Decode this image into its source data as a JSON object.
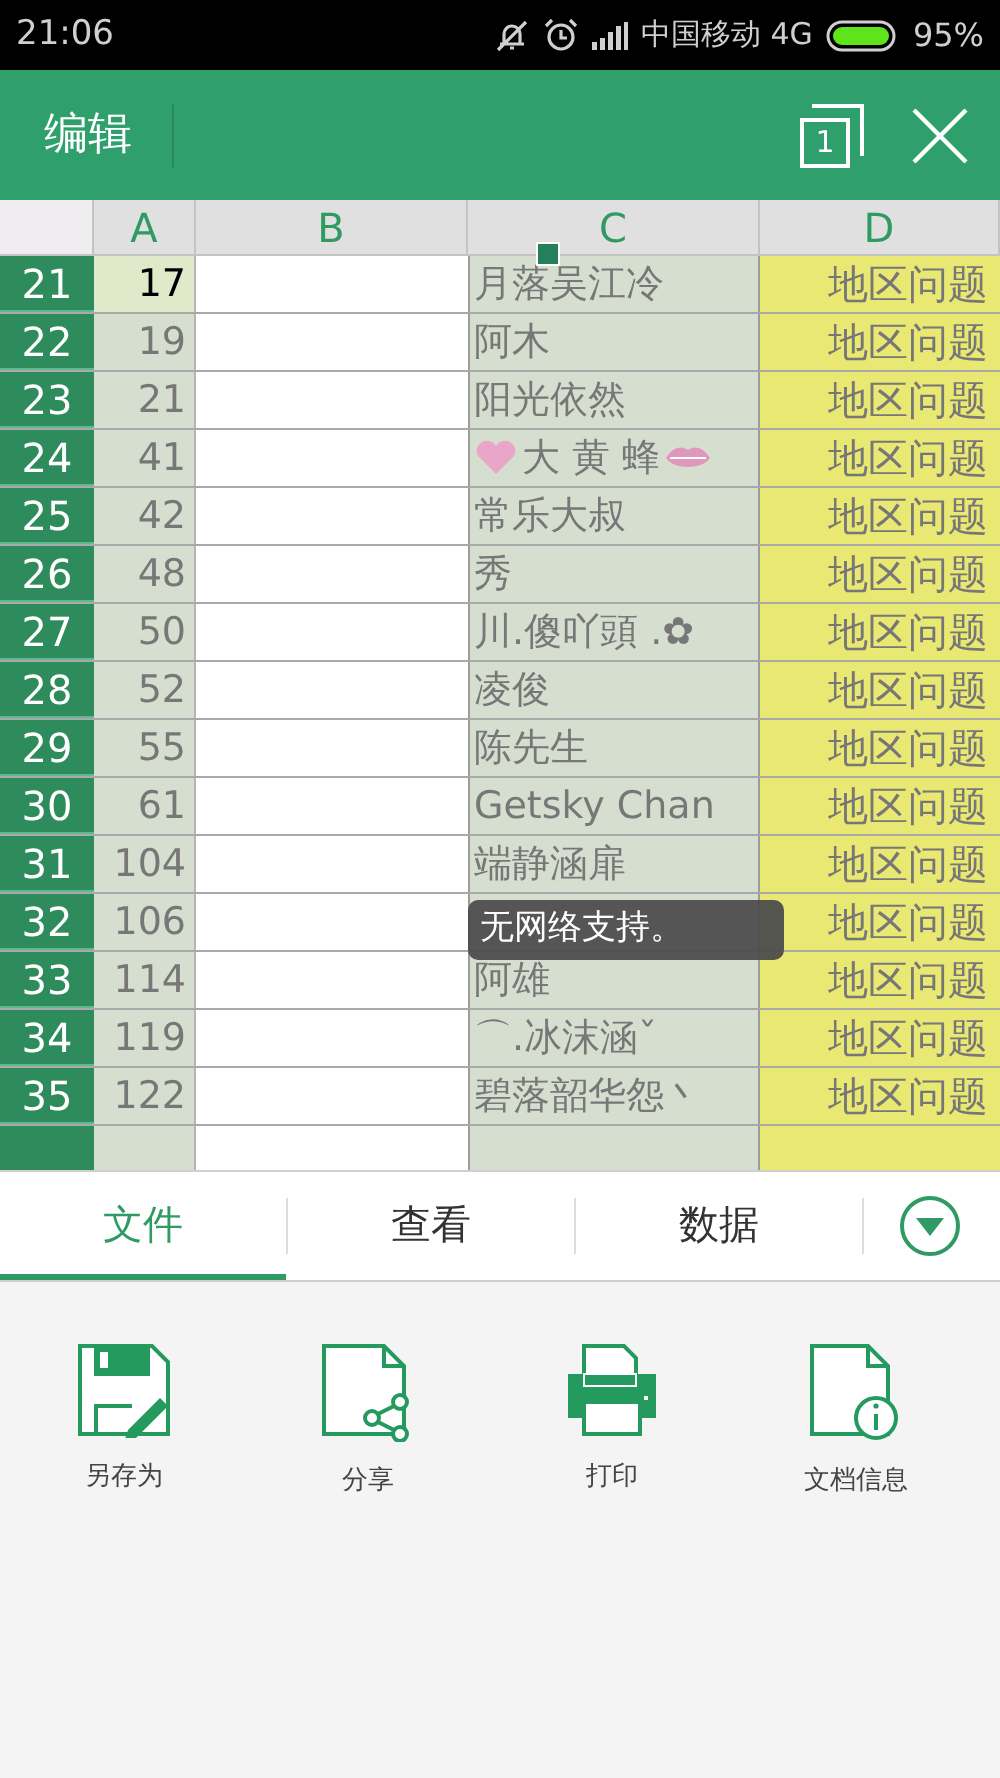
{
  "status_bar": {
    "time": "21:06",
    "carrier": "中国移动 4G",
    "battery": "95%"
  },
  "toolbar": {
    "title": "编辑",
    "window_count": "1"
  },
  "sheet": {
    "columns": [
      "A",
      "B",
      "C",
      "D"
    ],
    "rows": [
      {
        "num": "21",
        "a": "17",
        "c": "月落吴江冷",
        "d": "地区问题",
        "selected": true
      },
      {
        "num": "22",
        "a": "19",
        "c": "阿木",
        "d": "地区问题",
        "selected": false
      },
      {
        "num": "23",
        "a": "21",
        "c": "阳光依然",
        "d": "地区问题",
        "selected": false
      },
      {
        "num": "24",
        "a": "41",
        "c": "大 黄 蜂",
        "d": "地区问题",
        "selected": false,
        "kind": "decorated"
      },
      {
        "num": "25",
        "a": "42",
        "c": "常乐大叔",
        "d": "地区问题",
        "selected": false
      },
      {
        "num": "26",
        "a": "48",
        "c": "秀",
        "d": "地区问题",
        "selected": false
      },
      {
        "num": "27",
        "a": "50",
        "c": "川.傻吖頭 .✿",
        "d": "地区问题",
        "selected": false
      },
      {
        "num": "28",
        "a": "52",
        "c": "凌俊",
        "d": "地区问题",
        "selected": false
      },
      {
        "num": "29",
        "a": "55",
        "c": "陈先生",
        "d": "地区问题",
        "selected": false
      },
      {
        "num": "30",
        "a": "61",
        "c": "Getsky Chan",
        "d": "地区问题",
        "selected": false
      },
      {
        "num": "31",
        "a": "104",
        "c": "端静涵扉",
        "d": "地区问题",
        "selected": false
      },
      {
        "num": "32",
        "a": "106",
        "d": "地区问题",
        "selected": false
      },
      {
        "num": "33",
        "a": "114",
        "c": "阿雄",
        "d": "地区问题",
        "selected": false
      },
      {
        "num": "34",
        "a": "119",
        "c": "⌒.冰沫涵ˇ",
        "d": "地区问题",
        "selected": false
      },
      {
        "num": "35",
        "a": "122",
        "c": "碧落韶华怨丶",
        "d": "地区问题",
        "selected": false
      }
    ]
  },
  "toast": "无网络支持。",
  "tabs": [
    {
      "label": "文件",
      "selected": true
    },
    {
      "label": "查看",
      "selected": false
    },
    {
      "label": "数据",
      "selected": false
    }
  ],
  "actions": [
    {
      "label": "另存为",
      "kind": "save"
    },
    {
      "label": "分享",
      "kind": "share"
    },
    {
      "label": "打印",
      "kind": "print"
    },
    {
      "label": "文档信息",
      "kind": "info"
    }
  ]
}
